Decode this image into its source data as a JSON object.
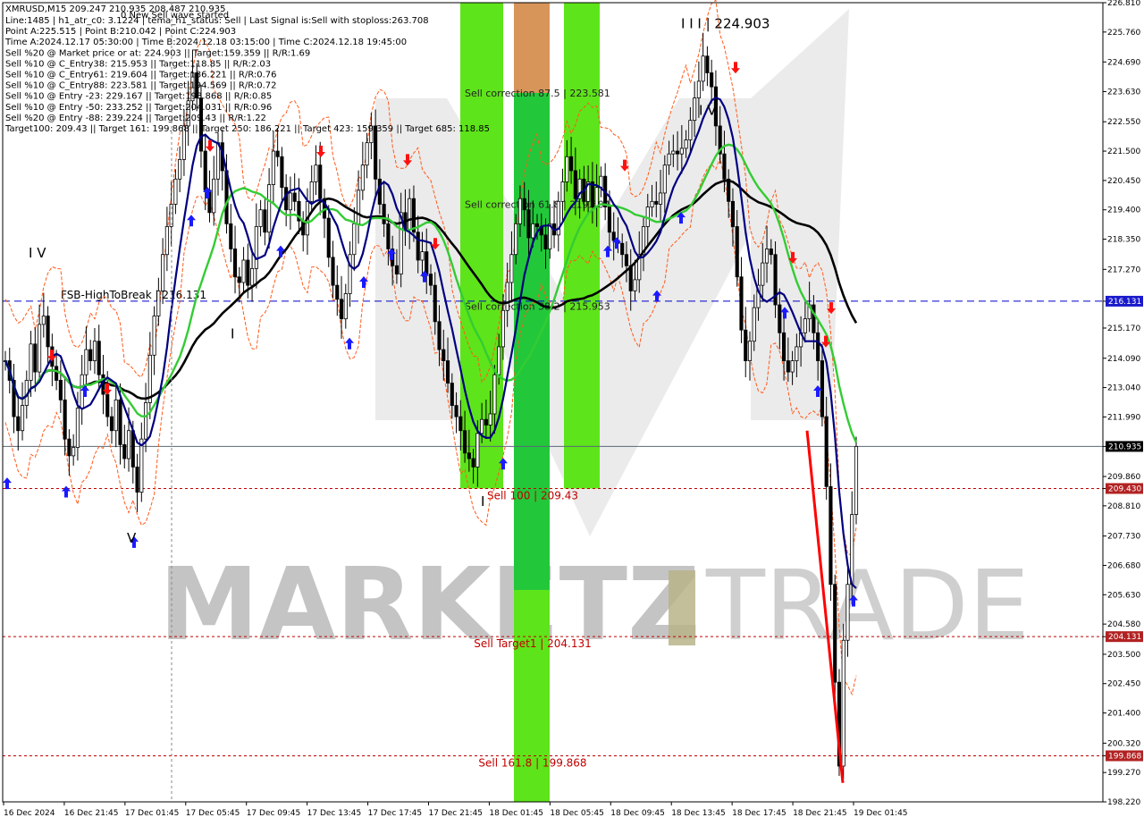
{
  "header": {
    "symbol_line": "XMRUSD,M15  209.247 210.935 208.487 210.935",
    "wave_notice": "0 New Sell wave started",
    "info_lines": [
      "Line:1485  |  h1_atr_c0: 3.1224  |  tema_h1_status: Sell  |  Last Signal is:Sell with stoploss:263.708",
      "Point A:225.515  |  Point B:210.042  |  Point C:224.903",
      "Time A:2024.12.17 05:30:00  |  Time B:2024.12.18 03:15:00  |  Time C:2024.12.18 19:45:00",
      "Sell %20 @ Market price or at: 224.903  ||  Target:159.359  ||  R/R:1.69",
      "Sell %10 @ C_Entry38: 215.953  ||  Target:118.85  ||  R/R:2.03",
      "Sell %10 @ C_Entry61: 219.604  ||  Target:186.221  ||  R/R:0.76",
      "Sell %10 @ C_Entry88: 223.581  ||  Target:194.569  ||  R/R:0.72",
      "Sell %10 @ Entry -23: 229.167  ||  Target:193.868  ||  R/R:0.85",
      "Sell %10 @ Entry -50: 233.252  ||  Target:204.031  ||  R/R:0.96",
      "Sell %20 @ Entry -88: 239.224  ||  Target:209.43  ||  R/R:1.22",
      "Target100: 209.43  ||  Target 161: 199.868  ||  Target 250: 186.221  ||  Target 423: 159.359  ||  Target 685: 118.85"
    ]
  },
  "watermark": {
    "left": "MARKETZ",
    "right": "TRADE"
  },
  "colors": {
    "background": "#ffffff",
    "green_zone": "#22c83a",
    "green_zone_light": "#5ee41a",
    "orange_zone": "#d7955a",
    "sell_line": "#ff0000",
    "up_arrow": "#1a1aff",
    "down_arrow": "#ff1010",
    "dashed_red": "#c00000",
    "dashed_blue": "#0000cc",
    "ma_black": "#000000",
    "ma_green": "#33cc33",
    "ma_navy": "#000080",
    "envelope": "#ff5a1a",
    "price_tag_red": "#b22222",
    "price_tag_blue": "#1a1acc",
    "price_tag_black": "#000000"
  },
  "chart_data": {
    "type": "candlestick",
    "symbol": "XMRUSD",
    "timeframe": "M15",
    "ylim": [
      198.22,
      226.81
    ],
    "y_ticks": [
      "226.810",
      "225.760",
      "224.690",
      "223.630",
      "222.550",
      "221.500",
      "220.450",
      "219.400",
      "218.350",
      "217.270",
      "216.131",
      "215.170",
      "214.090",
      "213.040",
      "211.990",
      "210.935",
      "209.860",
      "209.430",
      "208.810",
      "207.730",
      "206.680",
      "205.630",
      "204.580",
      "204.131",
      "203.500",
      "202.450",
      "201.400",
      "200.320",
      "199.868",
      "199.270",
      "198.220"
    ],
    "x_ticks": [
      "16 Dec 2024",
      "16 Dec 21:45",
      "17 Dec 01:45",
      "17 Dec 05:45",
      "17 Dec 09:45",
      "17 Dec 13:45",
      "17 Dec 17:45",
      "17 Dec 21:45",
      "18 Dec 01:45",
      "18 Dec 05:45",
      "18 Dec 09:45",
      "18 Dec 13:45",
      "18 Dec 17:45",
      "18 Dec 21:45",
      "19 Dec 01:45"
    ],
    "current_price": 210.935,
    "price_tags": [
      {
        "text": "216.131",
        "value": 216.131,
        "color": "blue"
      },
      {
        "text": "210.935",
        "value": 210.935,
        "color": "black"
      },
      {
        "text": "209.430",
        "value": 209.43,
        "color": "red"
      },
      {
        "text": "204.131",
        "value": 204.131,
        "color": "red"
      },
      {
        "text": "199.868",
        "value": 199.868,
        "color": "red"
      }
    ],
    "levels": [
      {
        "label": "FSB-HighToBreak | 216.131",
        "value": 216.131,
        "style": "blue-dashed"
      },
      {
        "label": "Sell 100 | 209.43",
        "value": 209.43,
        "style": "red-dashed"
      },
      {
        "label": "Sell Target1 | 204.131",
        "value": 204.131,
        "style": "red-dashed"
      },
      {
        "label": "Sell 161.8 | 199.868",
        "value": 199.868,
        "style": "red-dashed"
      }
    ],
    "zones": [
      {
        "label": "Sell correction 87.5 | 223.581",
        "value": 223.581
      },
      {
        "label": "Sell correction 61.8 | 219.604",
        "value": 219.604
      },
      {
        "label": "Sell correction 38.2 | 215.953",
        "value": 215.953
      }
    ],
    "wave_labels": [
      {
        "text": "I V",
        "value": 217.7
      },
      {
        "text": "I I I | 224.903",
        "value": 225.9
      },
      {
        "text": "I V",
        "value": 222.8
      },
      {
        "text": "I",
        "value": 214.8
      },
      {
        "text": "V",
        "value": 207.5
      },
      {
        "text": "I",
        "value": 208.8
      }
    ],
    "closes": [
      214.0,
      213.3,
      212.0,
      211.5,
      212.4,
      213.3,
      214.6,
      213.6,
      215.3,
      215.6,
      214.5,
      213.8,
      213.3,
      212.6,
      211.2,
      210.6,
      210.9,
      212.3,
      213.5,
      214.4,
      214.0,
      214.7,
      213.5,
      212.8,
      212.0,
      211.5,
      212.6,
      211.0,
      210.5,
      211.5,
      210.2,
      209.3,
      211.2,
      212.5,
      214.2,
      215.6,
      216.5,
      217.8,
      218.8,
      219.6,
      220.5,
      221.2,
      222.4,
      223.3,
      224.3,
      223.4,
      221.5,
      220.1,
      219.3,
      220.5,
      221.8,
      220.8,
      218.9,
      218.0,
      217.0,
      216.8,
      217.6,
      216.7,
      217.3,
      218.8,
      219.4,
      218.6,
      220.3,
      221.5,
      221.3,
      220.2,
      219.4,
      220.0,
      219.7,
      219.0,
      218.5,
      219.7,
      220.4,
      221.0,
      219.8,
      219.1,
      217.7,
      216.7,
      216.2,
      215.5,
      216.4,
      217.8,
      218.9,
      220.1,
      221.0,
      221.8,
      222.4,
      220.5,
      219.6,
      218.9,
      218.0,
      217.4,
      217.1,
      219.3,
      218.7,
      219.8,
      218.6,
      217.6,
      217.9,
      217.1,
      216.7,
      215.4,
      214.4,
      214.0,
      213.2,
      212.4,
      212.0,
      211.5,
      210.7,
      210.5,
      210.2,
      211.4,
      211.9,
      211.7,
      212.1,
      213.5,
      214.5,
      215.8,
      216.8,
      217.8,
      218.9,
      219.8,
      219.4,
      218.4,
      218.9,
      218.8,
      218.5,
      218.0,
      218.9,
      218.5,
      219.7,
      220.4,
      221.3,
      220.8,
      219.8,
      220.5,
      219.7,
      220.4,
      219.5,
      220.2,
      220.6,
      219.5,
      218.6,
      218.3,
      218.2,
      217.8,
      217.4,
      216.5,
      216.9,
      217.8,
      218.8,
      219.5,
      219.7,
      219.6,
      220.0,
      221.0,
      221.4,
      221.5,
      221.4,
      221.6,
      221.9,
      222.6,
      223.4,
      224.0,
      224.9,
      224.3,
      223.8,
      222.4,
      221.4,
      220.5,
      219.7,
      218.8,
      217.0,
      215.1,
      214.0,
      214.7,
      215.9,
      216.7,
      217.5,
      218.0,
      217.8,
      216.0,
      215.0,
      214.0,
      213.6,
      214.0,
      214.5,
      215.0,
      215.5,
      216.0,
      215.0,
      214.0,
      212.0,
      209.5,
      206.0,
      202.5,
      199.5,
      204.0,
      206.0,
      208.5,
      210.935
    ]
  }
}
